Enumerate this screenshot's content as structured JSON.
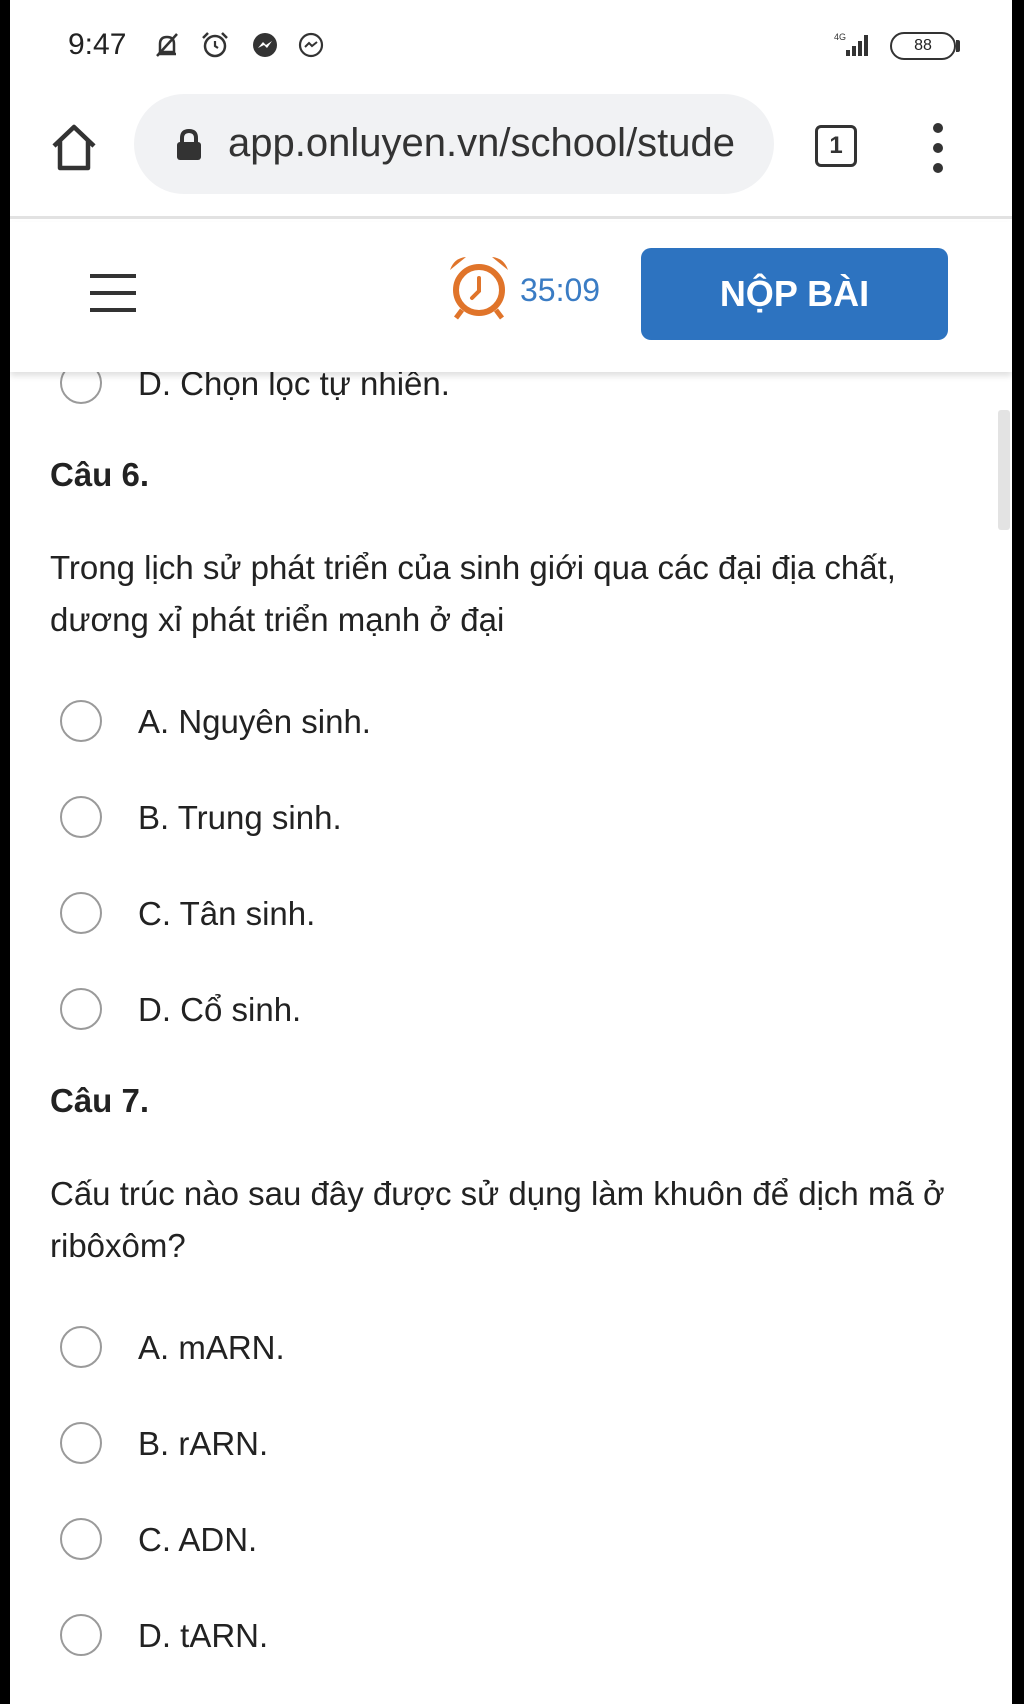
{
  "status_bar": {
    "time": "9:47",
    "battery": "88"
  },
  "browser": {
    "url": "app.onluyen.vn/school/stude",
    "tab_count": "1"
  },
  "header": {
    "timer": "35:09",
    "submit_label": "NỘP BÀI"
  },
  "prev_option": {
    "label": "D. Chọn lọc tự nhiên."
  },
  "questions": [
    {
      "title": "Câu 6.",
      "text": "Trong lịch sử phát triển của sinh giới qua các đại địa chất, dương xỉ phát triển mạnh ở đại",
      "options": [
        "A. Nguyên sinh.",
        "B. Trung sinh.",
        "C. Tân sinh.",
        "D. Cổ sinh."
      ]
    },
    {
      "title": "Câu 7.",
      "text": "Cấu trúc nào sau đây được sử dụng làm khuôn để dịch mã ở ribôxôm?",
      "options": [
        "A. mARN.",
        "B. rARN.",
        "C. ADN.",
        "D. tARN."
      ]
    }
  ],
  "colors": {
    "accent": "#2d73c0",
    "timer": "#3a7cc4",
    "alarm": "#e0742a"
  }
}
